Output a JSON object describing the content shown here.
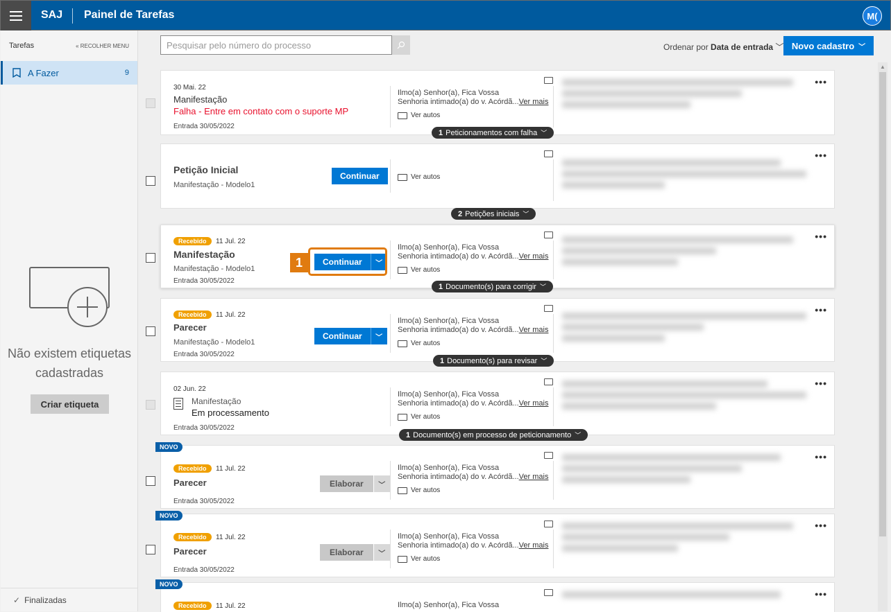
{
  "header": {
    "brand": "SAJ",
    "title": "Painel de Tarefas",
    "avatar": "M("
  },
  "sidebar": {
    "title": "Tarefas",
    "collapse_label": "« RECOLHER MENU",
    "item": {
      "label": "A Fazer",
      "count": "9"
    },
    "empty_line1": "Não existem etiquetas",
    "empty_line2": "cadastradas",
    "create_label_button": "Criar etiqueta",
    "footer": "Finalizadas"
  },
  "toolbar": {
    "search_placeholder": "Pesquisar pelo número do processo",
    "sort_prefix": "Ordenar por",
    "sort_value": "Data de entrada",
    "new_button": "Novo cadastro"
  },
  "common": {
    "party_line1": "Ilmo(a) Senhor(a), Fica Vossa",
    "party_line2": "Senhoria intimado(a) do v. Acórdã...",
    "see_more": "Ver mais",
    "see_autos": "Ver autos",
    "entry": "Entrada 30/05/2022",
    "received": "Recebido",
    "novo": "NOVO",
    "continue": "Continuar",
    "elaborate": "Elaborar"
  },
  "cards": [
    {
      "date": "30 Mai. 22",
      "title": "Manifestação",
      "error": "Falha - Entre em contato com o suporte MP",
      "pill_count": "1",
      "pill_text": "Peticionamentos com falha"
    },
    {
      "title": "Petição Inicial",
      "sub": "Manifestação - Modelo1",
      "pill_count": "2",
      "pill_text": "Petições iniciais"
    },
    {
      "badge_date": "11 Jul. 22",
      "title": "Manifestação",
      "sub": "Manifestação - Modelo1",
      "pill_count": "1",
      "pill_text": "Documento(s) para corrigir"
    },
    {
      "badge_date": "11 Jul. 22",
      "title": "Parecer",
      "sub": "Manifestação - Modelo1",
      "pill_count": "1",
      "pill_text": "Documento(s) para revisar"
    },
    {
      "date": "02 Jun. 22",
      "title": "Manifestação",
      "status": "Em processamento",
      "pill_count": "1",
      "pill_text": "Documento(s) em processo de peticionamento"
    },
    {
      "badge_date": "11 Jul. 22",
      "title": "Parecer"
    },
    {
      "badge_date": "11 Jul. 22",
      "title": "Parecer"
    },
    {
      "badge_date": "11 Jul. 22"
    }
  ],
  "highlight": {
    "step": "1"
  }
}
